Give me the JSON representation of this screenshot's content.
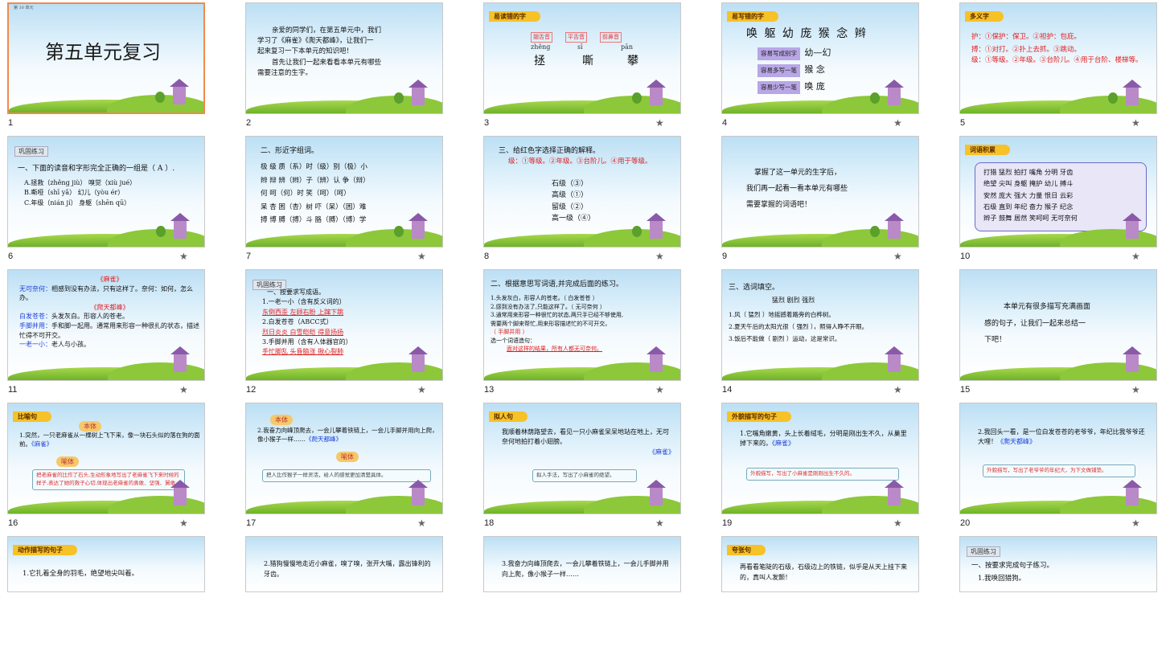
{
  "slides": [
    {
      "n": "1",
      "title": "第五单元复习",
      "corner": "第 10 单元"
    },
    {
      "n": "2",
      "lines": [
        "亲爱的同学们，在第五单元中，我们",
        "学习了《麻雀》《爬天都峰》，让我们一",
        "起来复习一下本单元的知识吧！",
        "首先让我们一起来看看本单元有哪些",
        "需要注意的生字。"
      ]
    },
    {
      "n": "3",
      "tag": "易读错的字",
      "labels": [
        "翘舌音",
        "平舌音",
        "前鼻音"
      ],
      "pinyin": [
        "zhěng",
        "sī",
        "pān"
      ],
      "chars": [
        "拯",
        "嘶",
        "攀"
      ]
    },
    {
      "n": "4",
      "tag": "易写错的字",
      "row": "唤 躯 幼 庞 猴 念 辫",
      "items": [
        {
          "k": "容易写成别字",
          "v": "幼—幻"
        },
        {
          "k": "容易多写一笔",
          "v": "猴  念"
        },
        {
          "k": "容易少写一笔",
          "v": "唤  庞"
        }
      ]
    },
    {
      "n": "5",
      "tag": "多义字",
      "lines": [
        {
          "c": "护：",
          "t": "①保护：保卫。②袒护：包庇。"
        },
        {
          "c": "搏：",
          "t": "①对打。②扑上去抓。③跳动。"
        },
        {
          "c": "级：",
          "t": "①等级。②年级。③台阶儿。④用于台阶、楼梯等。"
        }
      ]
    },
    {
      "n": "6",
      "tagbox": "巩固练习",
      "q": "一、下面的读音和字形完全正确的一组是（ A ）.",
      "opts": [
        "A.拯救（zhěng jiù）   嗅觉（xiù jué）",
        "B.嘶哑（shī yǎ）       幻儿（yòu ér）",
        "C.年级（nián jí）      身躯（shēn qū）"
      ]
    },
    {
      "n": "7",
      "q": "二、形近字组词。",
      "rows": [
        "极 级 质（系）时（级）别（极）小",
        "辫 辩 辨（辫）子（辨）认 争（辩）",
        "何   呵（何）时 笑（呵）（呵）",
        "呆 杏 困（杏）树 吓（呆）（困）难",
        "搏 博 膊（搏）斗 胳（膊）（博）学"
      ]
    },
    {
      "n": "8",
      "q": "三、给红色字选择正确的解释。",
      "def": "级：①等级。②年级。③台阶儿。④用于等级。",
      "items": [
        "石级（③）",
        "高级（①）",
        "留级（②）",
        "高一级（④）"
      ]
    },
    {
      "n": "9",
      "lines": [
        "掌握了这一单元的生字后，",
        "我们再一起看一看本单元有哪些",
        "需要掌握的词语吧！"
      ]
    },
    {
      "n": "10",
      "tag": "词语积累",
      "words": [
        "打猎  猛烈  拍打  嘴角  分明  牙齿",
        "绝望  尖叫  身躯  掩护  幼儿  搏斗",
        "安然  庞大  强大  力量  恨日  云彩",
        "石级  直到  年纪  奋力  猴子  纪念",
        "辫子  鼓舞  居然  笑呵呵  无可奈何"
      ]
    },
    {
      "n": "11",
      "title1": "《麻雀》",
      "title2": "《爬天都峰》",
      "items": [
        {
          "k": "无可奈何：",
          "v": "相感到没有办法，只有这样了。奈何：如何，怎么办。"
        },
        {
          "k": "白发苍苍：",
          "v": "头发灰白。形容人的苍老。"
        },
        {
          "k": "手脚并用：",
          "v": "手和脚一起用。通常用来形容一种很扎的状态，描述忙得不可开交。"
        },
        {
          "k": "一老一小：",
          "v": "老人与小孩。"
        }
      ]
    },
    {
      "n": "12",
      "tagbox": "巩固练习",
      "q": "一、按要求写成语。",
      "groups": [
        {
          "h": "1.一老一小（含有反义词的）",
          "a": "东倒西歪   左顾右盼   上蹿下跳"
        },
        {
          "h": "2.白发苍苍（ABCC式）",
          "a": "烈日炎炎   白雪皑皑   得意扬扬"
        },
        {
          "h": "3.手脚并用（含有人体器官的）",
          "a": "手忙脚乱   头昏脑涨   揪心裂肺"
        }
      ]
    },
    {
      "n": "13",
      "q": "二、根据意思写词语,并完成后面的练习。",
      "lines": [
        "1.头发灰白，形容人的苍老。（ 白发苍苍 ）",
        "2.感到没有办法了,只能这样了。（ 无可奈何 ）",
        "3.通常用来形容一种很忙的状态,两只手已经不够使用,",
        "需要两个脚来帮忙,用来形容描述忙的不可开交。",
        "（ 手脚并用 ）",
        "选一个词语造句：",
        "面对这样的结果，所有人都无可奈何。"
      ]
    },
    {
      "n": "14",
      "q": "三、选词填空。",
      "choices": "猛烈    剧烈    强烈",
      "lines": [
        "1.风（ 猛烈 ）地摇撼着路旁的白桦树。",
        "2.夏天午后的太阳光很（ 强烈 ），照得人睁不开眼。",
        "3.饭后不能做（ 剧烈 ）运动，这是常识。"
      ]
    },
    {
      "n": "15",
      "lines": [
        "本单元有很多描写充满画面",
        "感的句子，让我们一起来总结一",
        "下吧！"
      ]
    },
    {
      "n": "16",
      "tag": "比喻句",
      "pill1": "本体",
      "pill2": "喻体",
      "sent": "1.突然，一只老麻雀从一棵树上飞下来，像一块石头似的落在狗的面前。",
      "src": "《麻雀》",
      "note": "把老麻雀的比作了石头,生动形象地写出了老麻雀飞下来时候的样子,表达了她的救子心切,体现出老麻雀的勇敢、坚强、舅敢。"
    },
    {
      "n": "17",
      "pill1": "本体",
      "pill2": "喻体",
      "sent": "2.我奋力向峰顶爬去，一会儿攀着铁链上，一会儿手脚并用向上爬，像小猴子一样……",
      "src": "《爬天都峰》",
      "note": "把人比作猴子一样灵活，给人的感觉更加清楚具体。"
    },
    {
      "n": "18",
      "tag": "拟人句",
      "sent": "我顺着林荫路望去，看见一只小麻雀呆呆地站在地上，无可奈何地拍打着小翅膀。",
      "src": "《麻雀》",
      "note": "拟人手法，写出了小麻雀的绝望。"
    },
    {
      "n": "19",
      "tag": "外貌描写的句子",
      "sent": "1.它嘴角嫩黄，头上长着绒毛，分明是刚出生不久，从巢里掉下来的。",
      "src": "《麻雀》",
      "note": "外貌描写，写出了小麻雀是刚刚出生不久的。"
    },
    {
      "n": "20",
      "sent": "2.我回头一看，是一位白发苍苍的老爷爷，年纪比我爷爷还大哩！",
      "src": "《爬天都峰》",
      "note": "外貌描写，写出了老爷爷的年纪大，为下文做铺垫。"
    },
    {
      "n": "21",
      "tag": "动作描写的句子",
      "sent": "1.它扎着全身的羽毛，绝望地尖叫着。"
    },
    {
      "n": "22",
      "sent": "2.猎狗慢慢地走近小麻雀，嗅了嗅，张开大嘴，露出锋利的牙齿。"
    },
    {
      "n": "23",
      "sent": "3.我奋力向峰顶爬去，一会儿攀着铁链上，一会儿手脚并用向上爬，像小猴子一样……"
    },
    {
      "n": "24",
      "tag": "夸张句",
      "sent": "再看看笔陡的石级，石级边上的铁链，似乎是从天上挂下来的，真叫人发颤！"
    },
    {
      "n": "25",
      "tagbox": "巩固练习",
      "q": "一、按要求完成句子练习。",
      "line": "1.我唤回猎狗。"
    }
  ]
}
